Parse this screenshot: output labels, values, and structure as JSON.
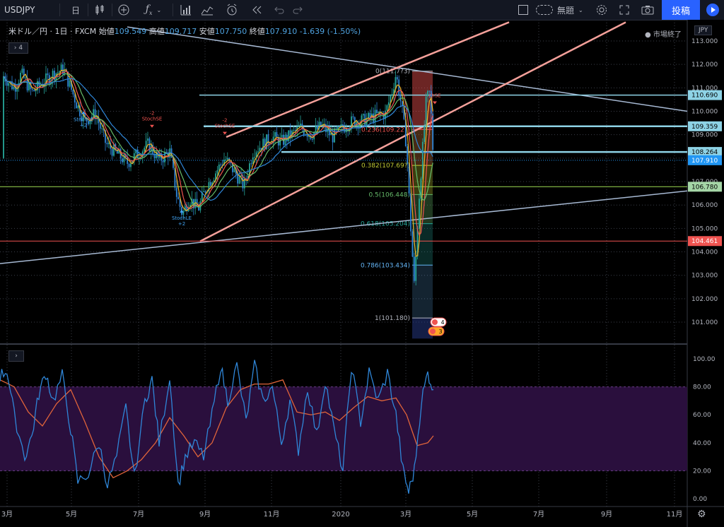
{
  "toolbar": {
    "symbol": "USDJPY",
    "interval": "日",
    "title_label": "無題",
    "publish_label": "投稿"
  },
  "legend": {
    "name": "米ドル／円 · 1日 · FXCM",
    "open_label": "始値",
    "open": "109.549",
    "high_label": "高値",
    "high": "109.717",
    "low_label": "安値",
    "low": "107.750",
    "close_label": "終値",
    "close": "107.910",
    "change": "-1.639 (-1.50%)",
    "indicator_count": "4",
    "market_status": "● 市場終了",
    "currency": "JPY"
  },
  "colors": {
    "up": "#26a69a",
    "down": "#ef5350",
    "channel": "#f4a09a",
    "trend": "#a7b9d3",
    "hline": "#8ed3e6",
    "stoch_d": "#e0643a",
    "stoch_k": "#2f86d8",
    "stoch_band": "#2a0f3d"
  },
  "price_axis": {
    "ticks": [
      "113.000",
      "112.000",
      "111.000",
      "110.000",
      "109.000",
      "108.000",
      "107.000",
      "106.000",
      "105.000",
      "104.000",
      "103.000",
      "102.000",
      "101.000"
    ],
    "labels": [
      {
        "value": "110.690",
        "bg": "#8ed3e6",
        "fg": "#000"
      },
      {
        "value": "109.359",
        "bg": "#8ed3e6",
        "fg": "#000"
      },
      {
        "value": "108.264",
        "bg": "#8ed3e6",
        "fg": "#000"
      },
      {
        "value": "107.910",
        "bg": "#2196f3",
        "fg": "#fff"
      },
      {
        "value": "106.780",
        "bg": "#a5d6a7",
        "fg": "#000"
      },
      {
        "value": "104.461",
        "bg": "#ef5350",
        "fg": "#fff"
      }
    ]
  },
  "stoch_axis": {
    "ticks": [
      "100.00",
      "80.00",
      "60.00",
      "40.00",
      "20.00",
      "0.00"
    ]
  },
  "time_axis": {
    "ticks": [
      "3月",
      "5月",
      "7月",
      "9月",
      "11月",
      "2020",
      "3月",
      "5月",
      "7月",
      "9月",
      "11月"
    ]
  },
  "fib": {
    "levels": [
      {
        "label": "0(111.7?3)",
        "color": "#b2b5be"
      },
      {
        "label": "0.236(109.22?)",
        "color": "#ef5350"
      },
      {
        "label": "0.382(107.69?)",
        "color": "#c0ca33"
      },
      {
        "label": "0.5(106.448)",
        "color": "#66bb6a"
      },
      {
        "label": "0.618(105.204)",
        "color": "#26a69a"
      },
      {
        "label": "0.786(103.434)",
        "color": "#64b5f6"
      },
      {
        "label": "1(101.180)",
        "color": "#b2b5be"
      }
    ]
  },
  "signals": [
    {
      "label": "StochLE",
      "sub": "2",
      "color": "#42a5f5"
    },
    {
      "label": "StochSE",
      "sub": "2",
      "color": "#ef5350"
    },
    {
      "label": "StochSE",
      "sub": "2",
      "color": "#ef5350"
    },
    {
      "label": "StochLE",
      "sub": "2",
      "color": "#42a5f5"
    },
    {
      "label": "chSE",
      "sub": "",
      "color": "#ef5350"
    }
  ],
  "events": [
    {
      "count": "4"
    },
    {
      "count": "3"
    }
  ],
  "chart_data": {
    "type": "candlestick",
    "symbol": "USDJPY",
    "ohlc_last": {
      "open": 109.549,
      "high": 109.717,
      "low": 107.75,
      "close": 107.91
    },
    "ylim": [
      100.5,
      113.3
    ],
    "x_range": [
      "2019-03",
      "2020-11"
    ],
    "close_approx": [
      {
        "date": "2019-03",
        "close": 111.5
      },
      {
        "date": "2019-04",
        "close": 111.7
      },
      {
        "date": "2019-05",
        "close": 109.6
      },
      {
        "date": "2019-06",
        "close": 107.8
      },
      {
        "date": "2019-07",
        "close": 108.4
      },
      {
        "date": "2019-08",
        "close": 105.6
      },
      {
        "date": "2019-09",
        "close": 107.9
      },
      {
        "date": "2019-10",
        "close": 108.3
      },
      {
        "date": "2019-11",
        "close": 109.4
      },
      {
        "date": "2019-12",
        "close": 109.3
      },
      {
        "date": "2020-01",
        "close": 109.1
      },
      {
        "date": "2020-02",
        "close": 110.5
      },
      {
        "date": "2020-03",
        "close": 107.9
      }
    ],
    "horizontal_lines": [
      110.69,
      109.359,
      108.264,
      106.78,
      104.461
    ],
    "fibonacci": {
      "0": 111.713,
      "0.236": 109.22,
      "0.382": 107.69,
      "0.5": 106.448,
      "0.618": 105.204,
      "0.786": 103.434,
      "1": 101.18
    },
    "stochastic": {
      "upper_band": 80,
      "lower_band": 20,
      "ylim": [
        0,
        100
      ]
    }
  }
}
